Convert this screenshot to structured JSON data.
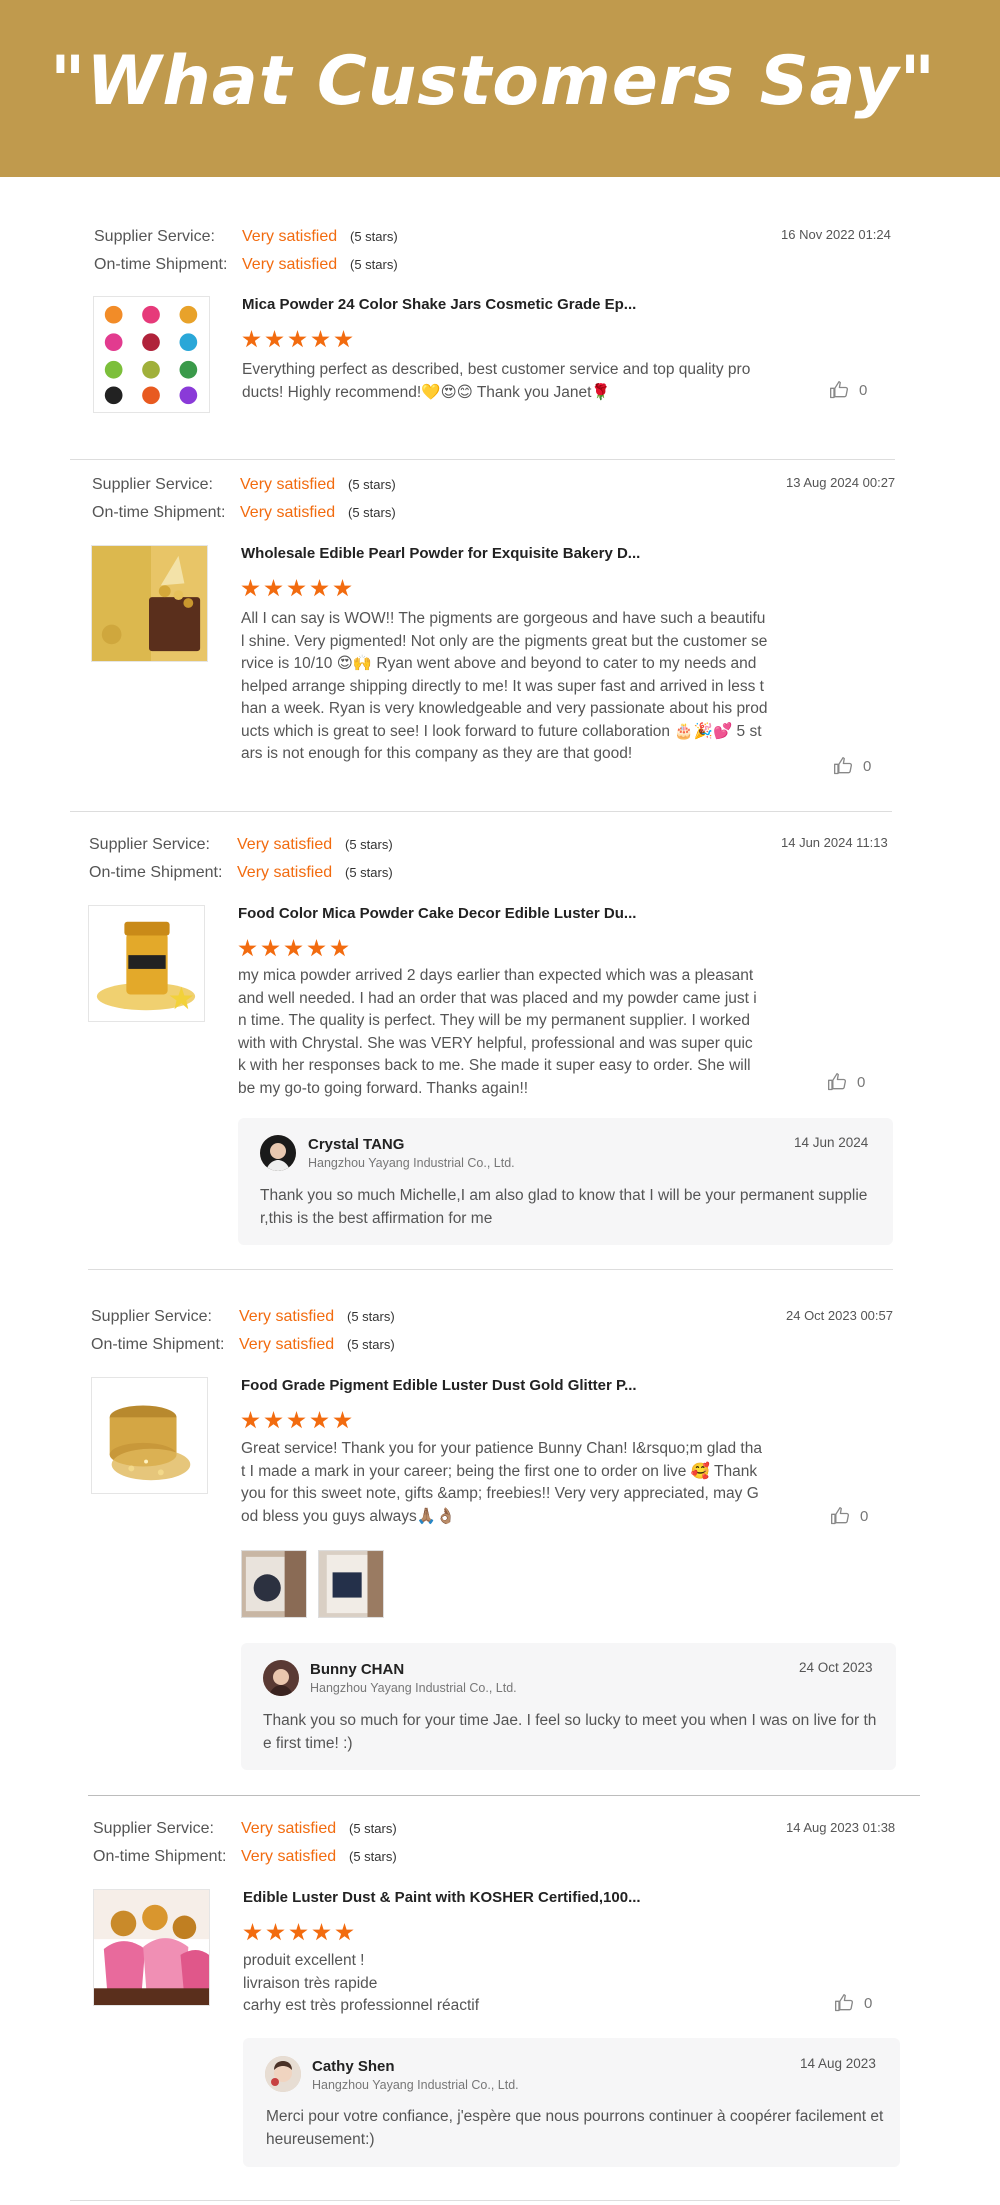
{
  "header": {
    "title": "\"What Customers Say\""
  },
  "labels": {
    "supplier_service": "Supplier Service:",
    "on_time_shipment": "On-time Shipment:",
    "satisfaction": "Very satisfied",
    "stars_text": "(5 stars)",
    "company": "Hangzhou Yayang Industrial Co., Ltd."
  },
  "colors": {
    "banner": "#c09a4d",
    "accent": "#f26b0f"
  },
  "reviews": [
    {
      "date": "16 Nov 2022 01:24",
      "product": "Mica Powder 24 Color Shake Jars Cosmetic Grade Ep...",
      "rating": 5,
      "comment": "Everything perfect as described, best customer service and top quality products! Highly recommend!💛😍😊 Thank you Janet🌹",
      "likes": "0"
    },
    {
      "date": "13 Aug 2024 00:27",
      "product": "Wholesale Edible Pearl Powder for Exquisite Bakery D...",
      "rating": 5,
      "comment": "All I can say is WOW!! The pigments are gorgeous and have such a beautiful shine. Very pigmented! Not only are the pigments great but the customer service is 10/10 😍🙌 Ryan went above and beyond to cater to my needs and helped arrange shipping directly to me! It was super fast and arrived in less than a week. Ryan is very knowledgeable and very passionate about his products which is great to see! I look forward to future collaboration 🎂🎉💕  5 stars is not enough for this company as they are that good!",
      "likes": "0"
    },
    {
      "date": "14 Jun 2024 11:13",
      "product": "Food Color Mica Powder Cake Decor Edible Luster Du...",
      "rating": 5,
      "comment": "my mica powder arrived 2 days earlier than expected which was a pleasant and well needed. I had an order that was placed and my powder came just in time.  The quality is perfect.  They will be my permanent supplier.  I worked with with Chrystal.  She was VERY helpful, professional and was super quick with her responses back to me.  She made it super easy to order.  She will be my go-to going forward.  Thanks again!!",
      "likes": "0",
      "reply": {
        "name": "Crystal TANG",
        "date": "14 Jun 2024",
        "text": "Thank you so much Michelle,I am also glad to know that I will be your permanent supplier,this is the best affirmation for me"
      }
    },
    {
      "date": "24 Oct 2023 00:57",
      "product": "Food Grade Pigment Edible Luster Dust Gold Glitter P...",
      "rating": 5,
      "comment": "Great service! Thank you for your patience Bunny Chan! I&rsquo;m glad that I made a mark in your career; being the first one to order on live 🥰 Thank you for this sweet note, gifts &amp; freebies!! Very very appreciated, may God bless you guys always🙏🏽👌🏽",
      "likes": "0",
      "reply": {
        "name": "Bunny CHAN",
        "date": "24 Oct 2023",
        "text": "Thank you so much for your time Jae. I feel so lucky to meet you when I was on live for the first time! :)"
      }
    },
    {
      "date": "14 Aug 2023 01:38",
      "product": "Edible Luster Dust & Paint with KOSHER Certified,100...",
      "rating": 5,
      "comment": "produit excellent !\nlivraison très rapide\ncarhy est très professionnel réactif",
      "likes": "0",
      "reply": {
        "name": "Cathy Shen",
        "date": "14 Aug 2023",
        "text": "Merci pour votre confiance, j'espère que nous pourrons continuer à coopérer facilement et heureusement:)"
      }
    }
  ]
}
